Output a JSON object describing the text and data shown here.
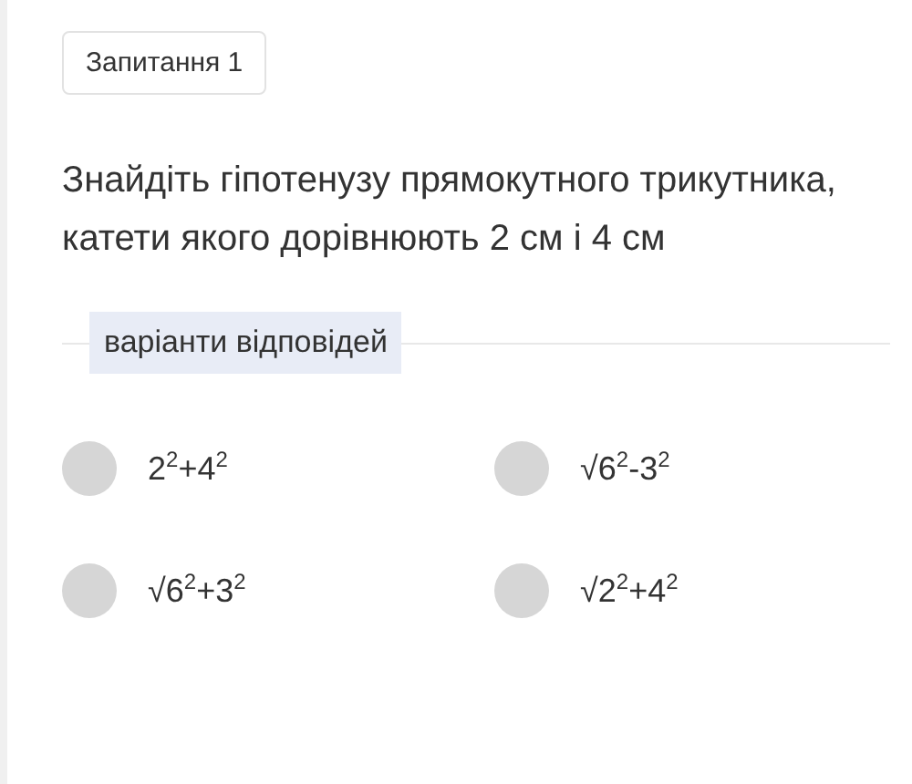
{
  "question_badge": "Запитання 1",
  "question": "Знайдіть гіпотенузу прямокутного трикутника, катети якого дорівнюють 2 см і 4 см",
  "answers_label": "варіанти відповідей",
  "options": [
    {
      "text": "2$^{2}$+4$^{2}$",
      "selected": false
    },
    {
      "text": "√6$^{2}$-3$^{2}$",
      "selected": false
    },
    {
      "text": "√6$^{2}$+3$^{2}$",
      "selected": false
    },
    {
      "text": "√2$^{2}$+4$^{2}$",
      "selected": false
    }
  ]
}
